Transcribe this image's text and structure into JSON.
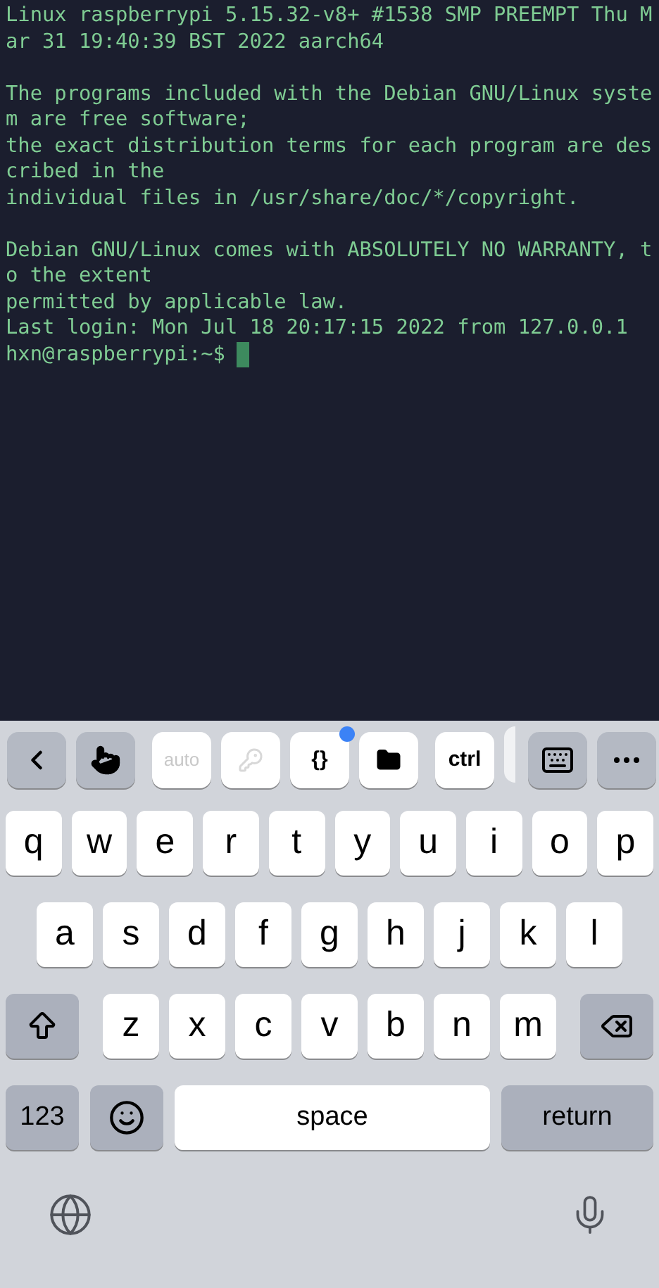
{
  "terminal": {
    "paragraphs": [
      [
        "Linux raspberrypi 5.15.32-v8+ #1538 SMP PREEMPT Thu M",
        "ar 31 19:40:39 BST 2022 aarch64"
      ],
      [
        "The programs included with the Debian GNU/Linux syste",
        "m are free software;",
        "the exact distribution terms for each program are des",
        "cribed in the",
        "individual files in /usr/share/doc/*/copyright."
      ],
      [
        "Debian GNU/Linux comes with ABSOLUTELY NO WARRANTY, t",
        "o the extent",
        "permitted by applicable law.",
        "Last login: Mon Jul 18 20:17:15 2022 from 127.0.0.1"
      ]
    ],
    "prompt": "hxn@raspberrypi:~$"
  },
  "toolbar": [
    {
      "kind": "back"
    },
    {
      "kind": "touch"
    },
    {
      "kind": "text",
      "label": "auto",
      "disabled": true
    },
    {
      "kind": "key",
      "disabled": true
    },
    {
      "kind": "braces",
      "label": "{}",
      "badge": true
    },
    {
      "kind": "folder"
    },
    {
      "kind": "text",
      "label": "ctrl",
      "disabled": false
    },
    {
      "kind": "partial"
    },
    {
      "kind": "keyboard"
    },
    {
      "kind": "more"
    }
  ],
  "keyboard": {
    "key_rows": [
      [
        {
          "kind": "letter",
          "label": "q"
        },
        {
          "kind": "letter",
          "label": "w"
        },
        {
          "kind": "letter",
          "label": "e"
        },
        {
          "kind": "letter",
          "label": "r"
        },
        {
          "kind": "letter",
          "label": "t"
        },
        {
          "kind": "letter",
          "label": "y"
        },
        {
          "kind": "letter",
          "label": "u"
        },
        {
          "kind": "letter",
          "label": "i"
        },
        {
          "kind": "letter",
          "label": "o"
        },
        {
          "kind": "letter",
          "label": "p"
        }
      ],
      [
        {
          "kind": "letter",
          "label": "a"
        },
        {
          "kind": "letter",
          "label": "s"
        },
        {
          "kind": "letter",
          "label": "d"
        },
        {
          "kind": "letter",
          "label": "f"
        },
        {
          "kind": "letter",
          "label": "g"
        },
        {
          "kind": "letter",
          "label": "h"
        },
        {
          "kind": "letter",
          "label": "j"
        },
        {
          "kind": "letter",
          "label": "k"
        },
        {
          "kind": "letter",
          "label": "l"
        }
      ],
      [
        {
          "kind": "shift"
        },
        {
          "kind": "letter",
          "label": "z"
        },
        {
          "kind": "letter",
          "label": "x"
        },
        {
          "kind": "letter",
          "label": "c"
        },
        {
          "kind": "letter",
          "label": "v"
        },
        {
          "kind": "letter",
          "label": "b"
        },
        {
          "kind": "letter",
          "label": "n"
        },
        {
          "kind": "letter",
          "label": "m"
        },
        {
          "kind": "backspace"
        }
      ],
      [
        {
          "kind": "numbers",
          "label": "123"
        },
        {
          "kind": "emoji"
        },
        {
          "kind": "space",
          "label": "space"
        },
        {
          "kind": "return",
          "label": "return"
        }
      ]
    ]
  }
}
